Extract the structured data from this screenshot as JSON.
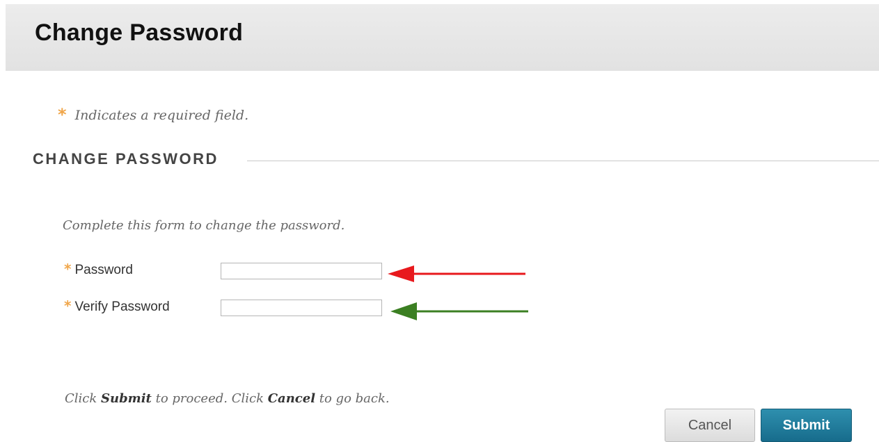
{
  "header": {
    "title": "Change Password"
  },
  "required_note": {
    "marker": "*",
    "text": "Indicates a required field."
  },
  "section": {
    "title": "CHANGE PASSWORD"
  },
  "form": {
    "instructions": "Complete this form to change the password.",
    "fields": [
      {
        "label": "Password",
        "value": "",
        "required": true
      },
      {
        "label": "Verify Password",
        "value": "",
        "required": true
      }
    ]
  },
  "footer": {
    "text_parts": [
      "Click ",
      "Submit",
      " to proceed. Click ",
      "Cancel",
      " to go back."
    ]
  },
  "buttons": {
    "cancel": "Cancel",
    "submit": "Submit"
  },
  "annotations": {
    "arrow_password_color": "#e8191d",
    "arrow_verify_color": "#3b7f22"
  }
}
